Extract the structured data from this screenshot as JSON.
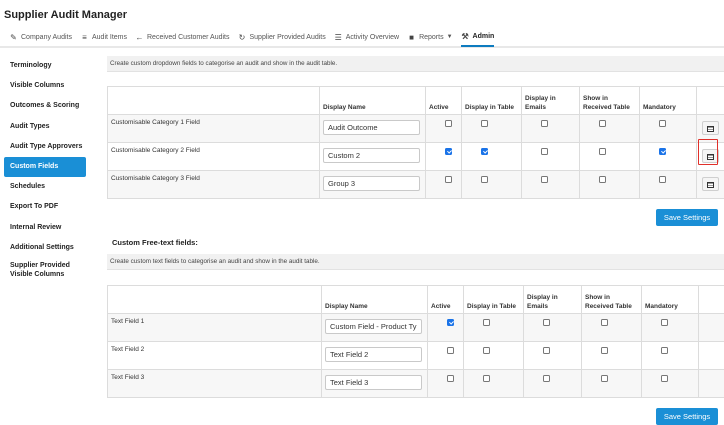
{
  "app": {
    "title": "Supplier Audit Manager"
  },
  "topnav": [
    {
      "icon": "edit-icon",
      "glyph": "✎",
      "label": "Company Audits"
    },
    {
      "icon": "list-icon",
      "glyph": "≡",
      "label": "Audit Items"
    },
    {
      "icon": "arrow-left-icon",
      "glyph": "←",
      "label": "Received Customer Audits"
    },
    {
      "icon": "refresh-icon",
      "glyph": "↻",
      "label": "Supplier Provided Audits"
    },
    {
      "icon": "table-icon",
      "glyph": "☰",
      "label": "Activity Overview"
    },
    {
      "icon": "file-icon",
      "glyph": "■",
      "label": "Reports"
    },
    {
      "icon": "wrench-icon",
      "glyph": "⚒",
      "label": "Admin"
    }
  ],
  "sidebar": [
    {
      "label": "Terminology"
    },
    {
      "label": "Visible Columns"
    },
    {
      "label": "Outcomes & Scoring"
    },
    {
      "label": "Audit Types"
    },
    {
      "label": "Audit Type Approvers"
    },
    {
      "label": "Custom Fields"
    },
    {
      "label": "Schedules"
    },
    {
      "label": "Export To PDF"
    },
    {
      "label": "Internal Review"
    },
    {
      "label": "Additional Settings"
    },
    {
      "label": "Supplier Provided\nVisible Columns"
    }
  ],
  "dropdown_section": {
    "description": "Create custom dropdown fields to categorise an audit and show in the audit table.",
    "headers": [
      "",
      "Display Name",
      "Active",
      "Display in Table",
      "Display in Emails",
      "Show in Received Table",
      "Mandatory",
      ""
    ],
    "rows": [
      {
        "name": "Customisable Category 1 Field",
        "display_name": "Audit Outcome",
        "active": false,
        "display_in_table": false,
        "display_in_emails": false,
        "show_in_received": false,
        "mandatory": false
      },
      {
        "name": "Customisable Category 2 Field",
        "display_name": "Custom 2",
        "active": true,
        "display_in_table": true,
        "display_in_emails": false,
        "show_in_received": false,
        "mandatory": true
      },
      {
        "name": "Customisable Category 3 Field",
        "display_name": "Group 3",
        "active": false,
        "display_in_table": false,
        "display_in_emails": false,
        "show_in_received": false,
        "mandatory": false
      }
    ],
    "save_label": "Save Settings"
  },
  "freetext_section": {
    "title": "Custom Free-text fields:",
    "description": "Create custom text fields to categorise an audit and show in the audit table.",
    "headers": [
      "",
      "Display Name",
      "Active",
      "Display in Table",
      "Display in Emails",
      "Show in Received Table",
      "Mandatory",
      ""
    ],
    "rows": [
      {
        "name": "Text Field 1",
        "display_name": "Custom Field - Product Ty",
        "active": true,
        "display_in_table": false,
        "display_in_emails": false,
        "show_in_received": false,
        "mandatory": false
      },
      {
        "name": "Text Field 2",
        "display_name": "Text Field 2",
        "active": false,
        "display_in_table": false,
        "display_in_emails": false,
        "show_in_received": false,
        "mandatory": false
      },
      {
        "name": "Text Field 3",
        "display_name": "Text Field 3",
        "active": false,
        "display_in_table": false,
        "display_in_emails": false,
        "show_in_received": false,
        "mandatory": false
      }
    ],
    "save_label": "Save Settings"
  },
  "colors": {
    "accent": "#1a8fd6",
    "highlight": "#e0302a",
    "checkbox_checked": "#1a73e8"
  }
}
